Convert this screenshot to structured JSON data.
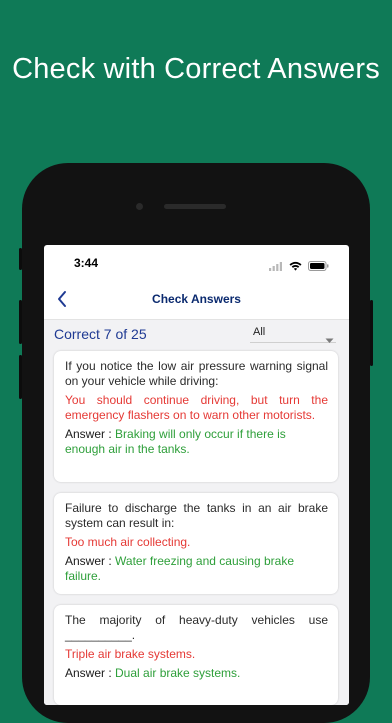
{
  "headline": "Check with Correct Answers",
  "status_bar": {
    "time": "3:44"
  },
  "nav": {
    "title": "Check Answers"
  },
  "score": {
    "text": "Correct 7 of 25"
  },
  "filter": {
    "selected": "All"
  },
  "answer_label": "Answer : ",
  "cards": [
    {
      "question": "If you notice the low air pressure warning signal on your vehicle while driving:",
      "your_answer": "You should continue driving, but turn the emergency flashers on to warn other motorists.",
      "correct_answer": "Braking will only occur if there is enough air in the tanks."
    },
    {
      "question": "Failure to discharge the tanks in an air brake system can result in:",
      "your_answer": "Too much air collecting.",
      "correct_answer": "Water freezing and causing brake failure."
    },
    {
      "question": "The majority of heavy-duty vehicles use __________.",
      "your_answer": "Triple air brake systems.",
      "correct_answer": "Dual air brake systems."
    }
  ],
  "colors": {
    "background": "#0f7a57",
    "nav_title": "#0b2a6f",
    "score": "#1f3a93",
    "wrong": "#e53935",
    "correct": "#2e9f3a"
  },
  "icons": [
    "wifi-icon",
    "battery-icon",
    "signal-icon",
    "back-chevron-icon",
    "dropdown-arrow-icon"
  ]
}
